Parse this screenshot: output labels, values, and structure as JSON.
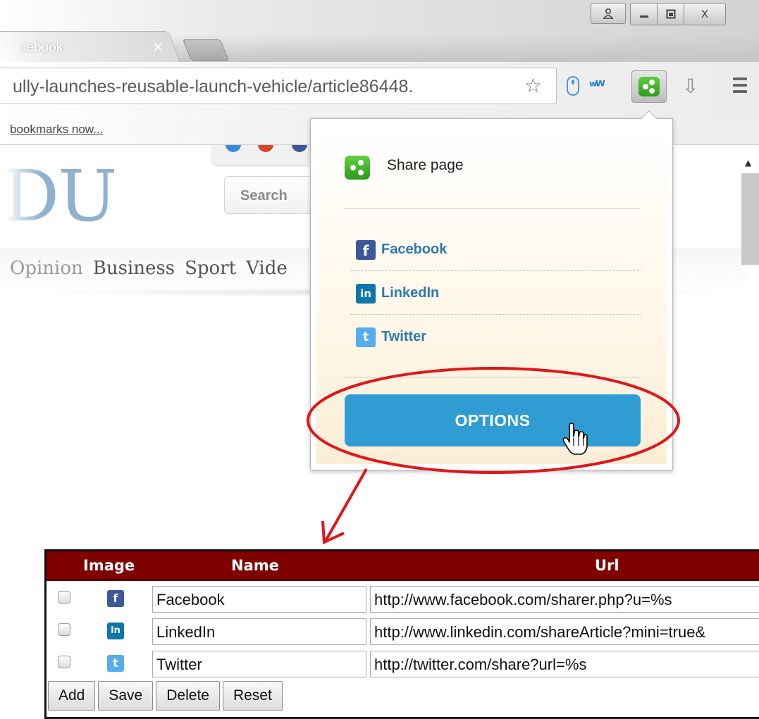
{
  "browser": {
    "tab_title": "cebook",
    "tab_close": "×",
    "url": "ully-launches-reusable-launch-vehicle/article86448.",
    "bookmarks_text": "bookmarks now...",
    "window_buttons": {
      "user": "👤",
      "minimize": "—",
      "maximize": "▣",
      "close": "X"
    },
    "extension_icons": [
      "mouse-icon",
      "wm-icon",
      "share-page-icon",
      "download-icon",
      "menu-icon"
    ]
  },
  "page": {
    "logo": "DU",
    "search_label": "Search",
    "nav": [
      "Opinion",
      "Business",
      "Sport",
      "Vide"
    ]
  },
  "popup": {
    "title": "Share page",
    "items": [
      {
        "label": "Facebook",
        "icon": "facebook-icon",
        "color": "#3b5998",
        "glyph": "f"
      },
      {
        "label": "LinkedIn",
        "icon": "linkedin-icon",
        "color": "#0e76a8",
        "glyph": "in"
      },
      {
        "label": "Twitter",
        "icon": "twitter-icon",
        "color": "#55acee",
        "glyph": "t"
      }
    ],
    "options_button": "OPTIONS"
  },
  "table": {
    "headers": {
      "image": "Image",
      "name": "Name",
      "url": "Url"
    },
    "rows": [
      {
        "name": "Facebook",
        "url": "http://www.facebook.com/sharer.php?u=%s",
        "icon": "facebook-icon"
      },
      {
        "name": "LinkedIn",
        "url": "http://www.linkedin.com/shareArticle?mini=true&",
        "icon": "linkedin-icon"
      },
      {
        "name": "Twitter",
        "url": "http://twitter.com/share?url=%s",
        "icon": "twitter-icon"
      }
    ],
    "buttons": {
      "add": "Add",
      "save": "Save",
      "delete": "Delete",
      "reset": "Reset"
    }
  },
  "colors": {
    "header_bg": "#800000",
    "options_button": "#2f9dd4",
    "annotation": "#e0161a",
    "link": "#2c78b0"
  }
}
